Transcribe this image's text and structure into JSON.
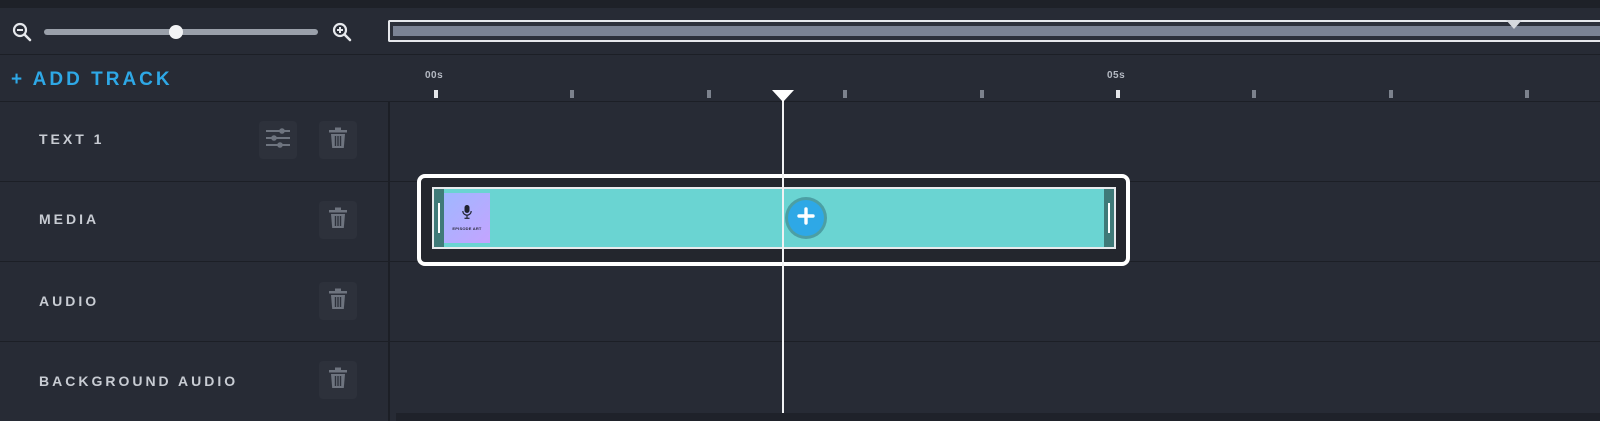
{
  "zoom": {
    "zoom_out_icon": "zoom-out-magnifier",
    "zoom_in_icon": "zoom-in-magnifier",
    "slider_level": 0.48
  },
  "toolbar": {
    "add_track_label": "+ ADD TRACK"
  },
  "ruler": {
    "labels": [
      "00s",
      "05s"
    ]
  },
  "tracks": [
    {
      "name": "TEXT 1",
      "has_settings": true
    },
    {
      "name": "MEDIA",
      "has_settings": false
    },
    {
      "name": "AUDIO",
      "has_settings": false
    },
    {
      "name": "BACKGROUND AUDIO",
      "has_settings": false
    }
  ],
  "clip": {
    "thumbnail_text": "EPISODE ART",
    "thumbnail_icon": "microphone-icon"
  },
  "colors": {
    "accent": "#2ea8e6",
    "clip_fill": "#6ad4d2",
    "background": "#272b35"
  }
}
